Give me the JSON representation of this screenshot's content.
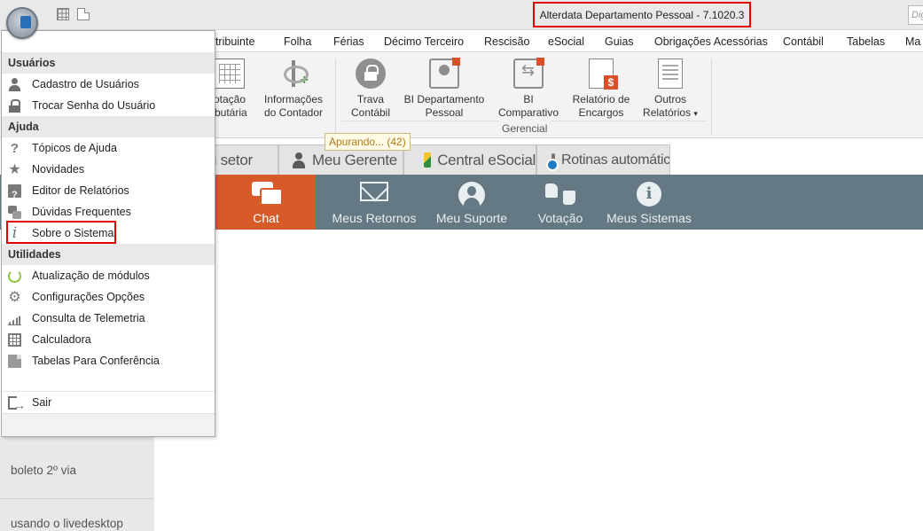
{
  "title_bar": {
    "app_title": "Alterdata Departamento Pessoal - 7.1020.3",
    "search_placeholder": "Dig"
  },
  "menu": {
    "items": [
      "ntribuinte",
      "Folha",
      "Férias",
      "Décimo Terceiro",
      "Rescisão",
      "eSocial",
      "Guias",
      "Obrigações Acessórias",
      "Contábil",
      "Tabelas",
      "Ma"
    ]
  },
  "ribbon": {
    "buttons": [
      {
        "label_line1": "otação",
        "label_line2": "ibutária",
        "icon": "calculator-doc-icon"
      },
      {
        "label_line1": "Informações",
        "label_line2": "do Contador",
        "icon": "caduceus-plus-icon"
      },
      {
        "label_line1": "Trava",
        "label_line2": "Contábil",
        "icon": "lock-icon"
      },
      {
        "label_line1": "BI Departamento",
        "label_line2": "Pessoal",
        "icon": "bi-person-icon"
      },
      {
        "label_line1": "BI",
        "label_line2": "Comparativo",
        "icon": "bi-compare-icon"
      },
      {
        "label_line1": "Relatório de",
        "label_line2": "Encargos",
        "icon": "report-dollar-icon"
      },
      {
        "label_line1": "Outros",
        "label_line2": "Relatórios",
        "icon": "report-list-icon"
      }
    ],
    "group_label": "Gerencial",
    "dropdown_arrow": "▾"
  },
  "tooltip": {
    "text": "Apurando... (42)"
  },
  "tabs": [
    {
      "label": "u setor"
    },
    {
      "label": "Meu Gerente",
      "icon": "person-icon"
    },
    {
      "label": "Central eSocial",
      "icon": "esocial-icon"
    },
    {
      "label": "Rotinas automáticas",
      "icon": "schedule-icon"
    }
  ],
  "actions": [
    {
      "label": "Chat",
      "icon": "chat-icon",
      "active": true
    },
    {
      "label": "Meus Retornos",
      "icon": "mail-icon"
    },
    {
      "label": "Meu Suporte",
      "icon": "support-icon"
    },
    {
      "label": "Votação",
      "icon": "vote-icon"
    },
    {
      "label": "Meus Sistemas",
      "icon": "info-icon"
    }
  ],
  "left_panel": {
    "items": [
      "boleto 2º via",
      "usando o livedesktop"
    ]
  },
  "dropdown": {
    "sections": [
      {
        "header": "Usuários",
        "items": [
          {
            "label": "Cadastro de Usuários",
            "icon": "user-icon"
          },
          {
            "label": "Trocar Senha do Usuário",
            "icon": "lock-icon"
          }
        ]
      },
      {
        "header": "Ajuda",
        "items": [
          {
            "label": "Tópicos de Ajuda",
            "icon": "help-icon"
          },
          {
            "label": "Novidades",
            "icon": "star-icon"
          },
          {
            "label": "Editor de Relatórios",
            "icon": "report-editor-icon"
          },
          {
            "label": "Dúvidas Frequentes",
            "icon": "faq-icon"
          },
          {
            "label": "Sobre o Sistema",
            "icon": "info-icon"
          }
        ]
      },
      {
        "header": "Utilidades",
        "items": [
          {
            "label": "Atualização de módulos",
            "icon": "refresh-icon"
          },
          {
            "label": "Configurações Opções",
            "icon": "gear-icon"
          },
          {
            "label": "Consulta de Telemetria",
            "icon": "telemetry-chart-icon"
          },
          {
            "label": "Calculadora",
            "icon": "calculator-icon"
          },
          {
            "label": "Tabelas Para Conferência",
            "icon": "tables-icon"
          }
        ]
      }
    ],
    "exit": {
      "label": "Sair",
      "icon": "exit-icon"
    }
  },
  "colors": {
    "accent_orange": "#d75a29",
    "action_bar": "#647984",
    "highlight_red": "#e00000"
  }
}
